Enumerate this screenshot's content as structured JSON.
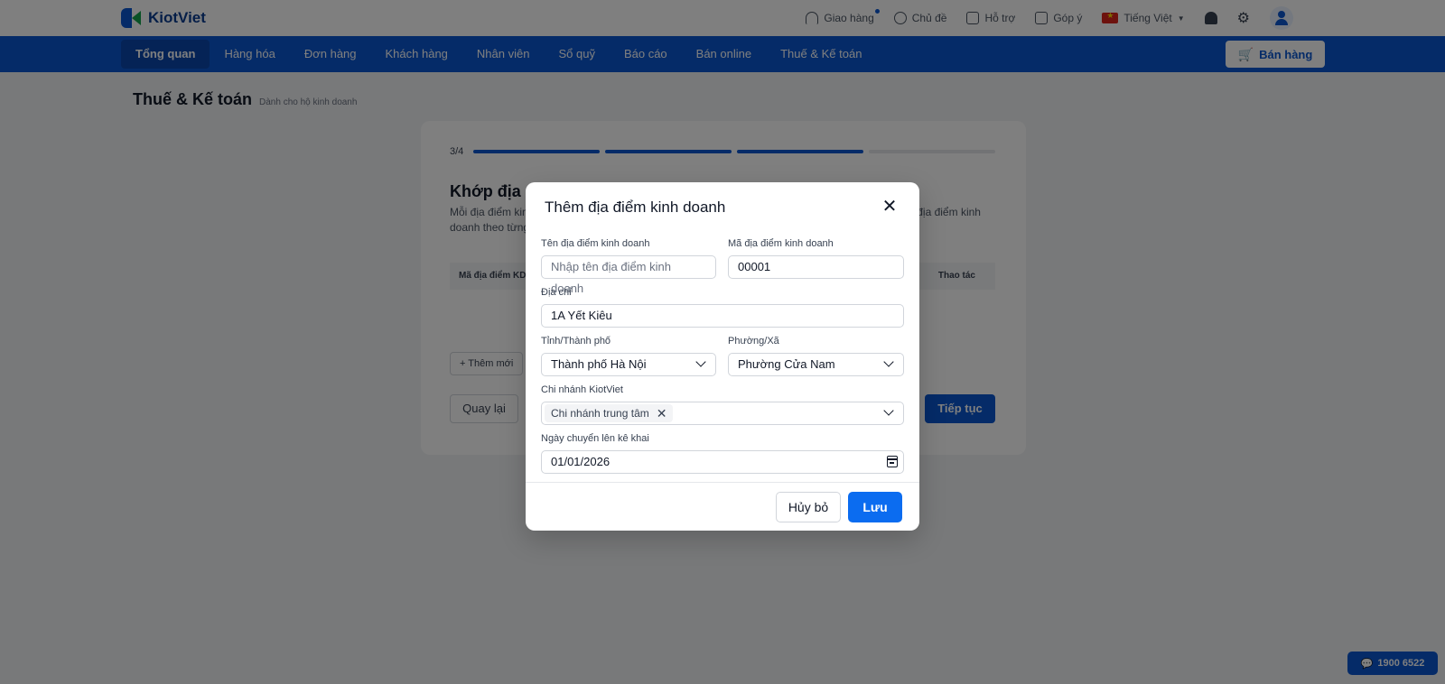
{
  "header": {
    "logo_text": "KiotViet",
    "actions": [
      {
        "label": "Giao hàng",
        "icon": "headset-icon"
      },
      {
        "label": "Chủ đề",
        "icon": "palette-icon"
      },
      {
        "label": "Hỗ trợ",
        "icon": "chat-icon"
      },
      {
        "label": "Góp ý",
        "icon": "feedback-icon"
      },
      {
        "label": "Tiếng Việt",
        "icon": "vietnam-flag-icon"
      }
    ]
  },
  "nav": {
    "items": [
      "Tổng quan",
      "Hàng hóa",
      "Đơn hàng",
      "Khách hàng",
      "Nhân viên",
      "Sổ quỹ",
      "Báo cáo",
      "Bán online",
      "Thuế & Kế toán"
    ],
    "active_index": 0,
    "sell_button": "Bán hàng"
  },
  "page": {
    "title": "Thuế & Kế toán",
    "subtitle": "Dành cho hộ kinh doanh"
  },
  "wizard": {
    "step_label": "3/4",
    "steps_total": 4,
    "steps_done": 3,
    "heading": "Khớp địa điểm kinh doanh",
    "description": "Mỗi địa điểm kinh doanh cần khớp với chi nhánh KiotViet để kê khai thuế. Vui lòng thêm và khớp địa điểm kinh doanh theo từng địa điểm.",
    "table_col_1": "Mã địa điểm KD",
    "table_col_2": "Thao tác",
    "add_new": "Thêm mới",
    "back_button": "Quay lại",
    "next_button": "Tiếp tục"
  },
  "hotline": "1900 6522",
  "modal": {
    "title": "Thêm địa điểm kinh doanh",
    "fields": {
      "name": {
        "label": "Tên địa điểm kinh doanh",
        "placeholder": "Nhập tên địa điểm kinh doanh",
        "value": ""
      },
      "code": {
        "label": "Mã địa điểm kinh doanh",
        "value": "00001"
      },
      "address": {
        "label": "Địa chỉ",
        "value": "1A Yết Kiêu"
      },
      "province": {
        "label": "Tỉnh/Thành phố",
        "value": "Thành phố Hà Nội"
      },
      "ward": {
        "label": "Phường/Xã",
        "value": "Phường Cửa Nam"
      },
      "branch": {
        "label": "Chi nhánh KiotViet",
        "selected": [
          "Chi nhánh trung tâm"
        ]
      },
      "date": {
        "label": "Ngày chuyển lên kê khai",
        "value": "01/01/2026"
      }
    },
    "cancel_button": "Hủy bỏ",
    "save_button": "Lưu"
  }
}
